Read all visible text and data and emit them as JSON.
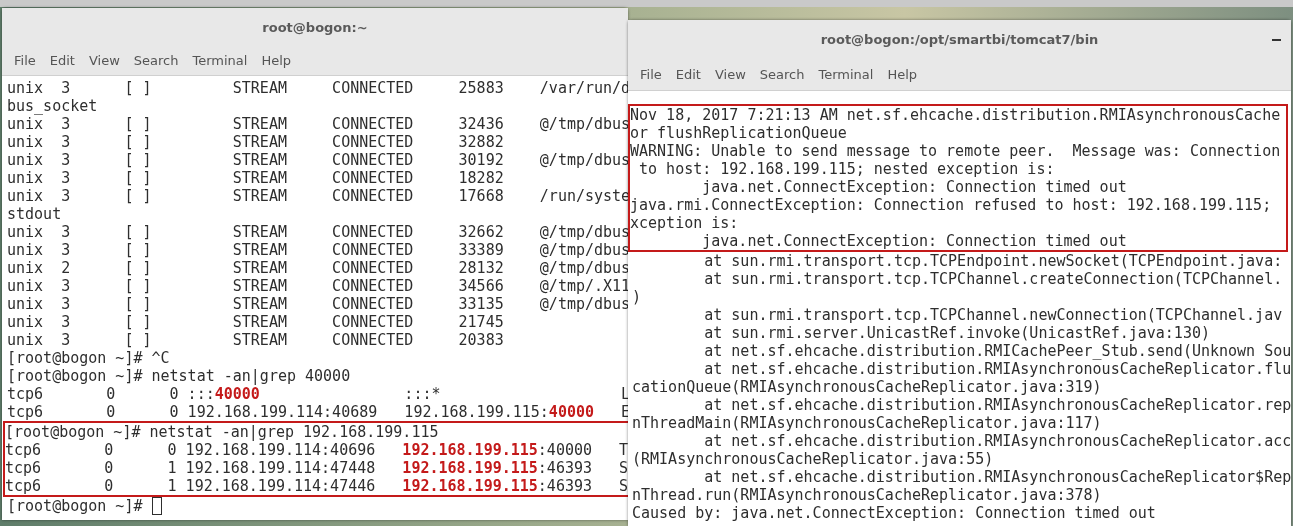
{
  "windows": [
    {
      "title": "root@bogon:~",
      "minimize_button": false,
      "cursor": true,
      "menu": [
        "File",
        "Edit",
        "View",
        "Search",
        "Terminal",
        "Help"
      ],
      "blocks": [
        {
          "highlighted": false,
          "lines": [
            "unix  3      [ ]         STREAM     CONNECTED     25883    /var/run/d",
            "bus_socket",
            "unix  3      [ ]         STREAM     CONNECTED     32436    @/tmp/dbus",
            "unix  3      [ ]         STREAM     CONNECTED     32882",
            "unix  3      [ ]         STREAM     CONNECTED     30192    @/tmp/dbus",
            "unix  3      [ ]         STREAM     CONNECTED     18282",
            "unix  3      [ ]         STREAM     CONNECTED     17668    /run/syste",
            "stdout",
            "unix  3      [ ]         STREAM     CONNECTED     32662    @/tmp/dbus",
            "unix  3      [ ]         STREAM     CONNECTED     33389    @/tmp/dbus",
            "unix  2      [ ]         STREAM     CONNECTED     28132    @/tmp/dbus",
            "unix  3      [ ]         STREAM     CONNECTED     34566    @/tmp/.X11",
            "unix  3      [ ]         STREAM     CONNECTED     33135    @/tmp/dbus",
            "unix  3      [ ]         STREAM     CONNECTED     21745",
            "unix  3      [ ]         STREAM     CONNECTED     20383",
            "[root@bogon ~]# ^C",
            "[root@bogon ~]# netstat -an|grep 40000",
            "tcp6       0      0 :::**40000**                :::*                    L",
            "tcp6       0      0 192.168.199.114:40689   192.168.199.115:**40000**   E"
          ]
        },
        {
          "highlighted": true,
          "lines": [
            "[root@bogon ~]# netstat -an|grep 192.168.199.115",
            "tcp6       0      0 192.168.199.114:40696   **192.168.199.115**:40000   T",
            "tcp6       0      1 192.168.199.114:47448   **192.168.199.115**:46393   S",
            "tcp6       0      1 192.168.199.114:47446   **192.168.199.115**:46393   S"
          ]
        },
        {
          "highlighted": false,
          "lines": [
            "[root@bogon ~]# "
          ]
        }
      ]
    },
    {
      "title": "root@bogon:/opt/smartbi/tomcat7/bin",
      "minimize_button": true,
      "cursor": false,
      "menu": [
        "File",
        "Edit",
        "View",
        "Search",
        "Terminal",
        "Help"
      ],
      "blocks": [
        {
          "highlighted": true,
          "lines": [
            "Nov 18, 2017 7:21:13 AM net.sf.ehcache.distribution.RMIAsynchronousCache",
            "or flushReplicationQueue",
            "WARNING: Unable to send message to remote peer.  Message was: Connection",
            " to host: 192.168.199.115; nested exception is:",
            "        java.net.ConnectException: Connection timed out",
            "java.rmi.ConnectException: Connection refused to host: 192.168.199.115;",
            "xception is:",
            "        java.net.ConnectException: Connection timed out"
          ]
        },
        {
          "highlighted": false,
          "lines": [
            "        at sun.rmi.transport.tcp.TCPEndpoint.newSocket(TCPEndpoint.java:",
            "        at sun.rmi.transport.tcp.TCPChannel.createConnection(TCPChannel.",
            ")",
            "        at sun.rmi.transport.tcp.TCPChannel.newConnection(TCPChannel.jav",
            "        at sun.rmi.server.UnicastRef.invoke(UnicastRef.java:130)",
            "        at net.sf.ehcache.distribution.RMICachePeer_Stub.send(Unknown Sou",
            "        at net.sf.ehcache.distribution.RMIAsynchronousCacheReplicator.flu",
            "cationQueue(RMIAsynchronousCacheReplicator.java:319)",
            "        at net.sf.ehcache.distribution.RMIAsynchronousCacheReplicator.rep",
            "nThreadMain(RMIAsynchronousCacheReplicator.java:117)",
            "        at net.sf.ehcache.distribution.RMIAsynchronousCacheReplicator.acc",
            "(RMIAsynchronousCacheReplicator.java:55)",
            "        at net.sf.ehcache.distribution.RMIAsynchronousCacheReplicator$Rep",
            "nThread.run(RMIAsynchronousCacheReplicator.java:378)",
            "Caused by: java.net.ConnectException: Connection timed out"
          ]
        }
      ]
    }
  ]
}
